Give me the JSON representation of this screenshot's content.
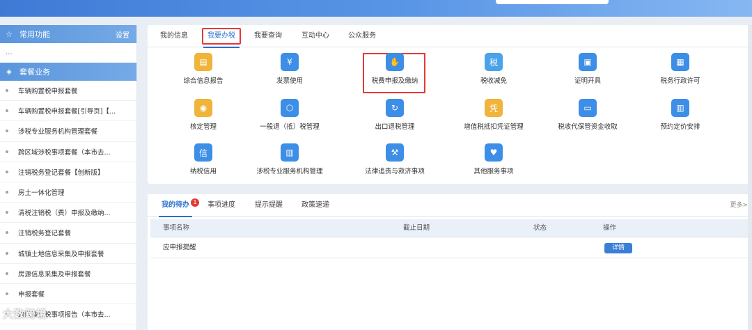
{
  "header": {
    "logo_text": ""
  },
  "sidebar": {
    "common_title": "常用功能",
    "settings_label": "设置",
    "dots": "...",
    "package_title": "套餐业务",
    "items": [
      "车辆购置税申报套餐",
      "车辆购置税申报套餐[引导页]【...",
      "涉税专业服务机构管理套餐",
      "跨区域涉税事项套餐（本市去...",
      "注销税务登记套餐【创新版】",
      "房土一体化管理",
      "清税注销税（费）申报及缴纳...",
      "注销税务登记套餐",
      "城镇土地信息采集及申报套餐",
      "房源信息采集及申报套餐",
      "申报套餐",
      "跨区域涉税事项报告（本市去..."
    ]
  },
  "tabs": [
    "我的信息",
    "我要办税",
    "我要查询",
    "互动中心",
    "公众服务"
  ],
  "tiles": [
    {
      "label": "综合信息报告",
      "icon": "report-icon",
      "color": "#f0b43a"
    },
    {
      "label": "发票使用",
      "icon": "invoice-icon",
      "color": "#3d8ee6"
    },
    {
      "label": "税费申报及缴纳",
      "icon": "hand-coin-icon",
      "color": "#3d8ee6"
    },
    {
      "label": "税收减免",
      "icon": "tax-card-icon",
      "color": "#4aa3e8"
    },
    {
      "label": "证明开具",
      "icon": "certificate-icon",
      "color": "#3d8ee6"
    },
    {
      "label": "税务行政许可",
      "icon": "license-icon",
      "color": "#3d8ee6"
    },
    {
      "label": "核定管理",
      "icon": "stamp-icon",
      "color": "#f0b43a"
    },
    {
      "label": "一般退（抵）税管理",
      "icon": "refund-icon",
      "color": "#3d8ee6"
    },
    {
      "label": "出口退税管理",
      "icon": "export-refund-icon",
      "color": "#3d8ee6"
    },
    {
      "label": "增值税抵扣凭证管理",
      "icon": "voucher-icon",
      "color": "#f0b43a"
    },
    {
      "label": "税收代保管资金收取",
      "icon": "fund-icon",
      "color": "#3d8ee6"
    },
    {
      "label": "预约定价安排",
      "icon": "calendar-icon",
      "color": "#3d8ee6"
    },
    {
      "label": "纳税信用",
      "icon": "credit-medal-icon",
      "color": "#3d8ee6"
    },
    {
      "label": "涉税专业服务机构管理",
      "icon": "building-icon",
      "color": "#3d8ee6"
    },
    {
      "label": "法律追责与救济事项",
      "icon": "gavel-icon",
      "color": "#3d8ee6"
    },
    {
      "label": "其他服务事项",
      "icon": "heart-hands-icon",
      "color": "#3d8ee6"
    }
  ],
  "todo": {
    "tabs": [
      "我的待办",
      "事项进度",
      "提示提醒",
      "政策速递"
    ],
    "badge": "1",
    "more": "更多>",
    "columns": [
      "事项名称",
      "截止日期",
      "状态",
      "操作"
    ],
    "rows": [
      {
        "name": "应申报提醒",
        "deadline": "",
        "status": "",
        "action": "详情"
      }
    ]
  },
  "watermark": "大数跨境"
}
